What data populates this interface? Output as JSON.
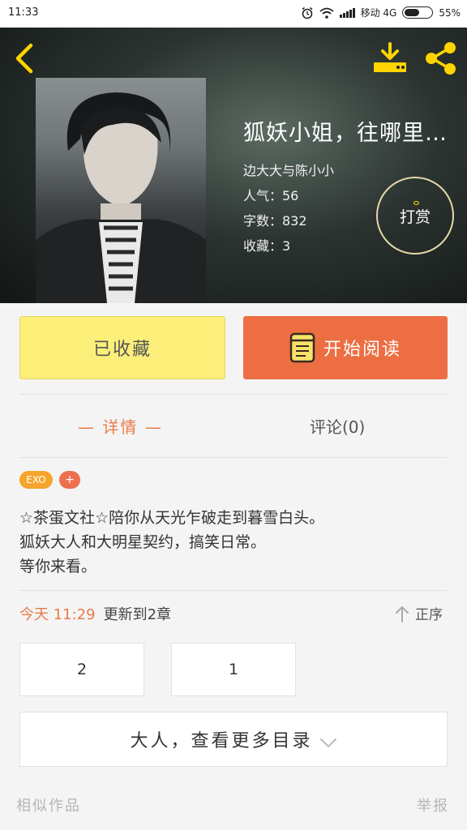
{
  "status_bar": {
    "time": "11:33",
    "carrier": "移动 4G",
    "battery": "55%",
    "battery_level": 0.55
  },
  "header": {
    "back_icon": "back-chevron-icon",
    "download_icon": "download-icon",
    "share_icon": "share-icon"
  },
  "book": {
    "title": "狐妖小姐，往哪里…",
    "author": "边大大与陈小小",
    "popularity": "人气：56",
    "word_count": "字数：832",
    "favorites": "收藏：3"
  },
  "tip_button_label": "打赏",
  "actions": {
    "favorite_label": "已收藏",
    "read_label": "开始阅读"
  },
  "tabs": {
    "details": "— 详情 —",
    "comments": "评论(0)"
  },
  "tags": [
    "EXO",
    "+"
  ],
  "description": [
    "☆茶蛋文社☆陪你从天光乍破走到暮雪白头。",
    "狐妖大人和大明星契约，搞笑日常。",
    "等你来看。"
  ],
  "update": {
    "date": "今天 11:29",
    "text": "更新到2章",
    "sort_label": "正序"
  },
  "chapters": [
    "2",
    "1"
  ],
  "more_catalog": "大人，查看更多目录",
  "footer": {
    "similar": "相似作品",
    "report": "举报"
  },
  "colors": {
    "accent_orange": "#ec6e42",
    "favorite_yellow": "#fbef7a",
    "icon_yellow": "#ffd400"
  }
}
